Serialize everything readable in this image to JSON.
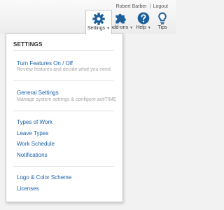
{
  "header": {
    "user_name": "Robert Barber",
    "logout_label": "Logout"
  },
  "nav": {
    "settings": {
      "label": "Settings",
      "icon": "gear-icon"
    },
    "addons": {
      "label": "Add-ons",
      "icon": "puzzle-icon"
    },
    "help": {
      "label": "Help",
      "icon": "help-icon"
    },
    "tips": {
      "label": "Tips",
      "icon": "lightbulb-icon"
    }
  },
  "menu": {
    "title": "SETTINGS",
    "turn_features": {
      "label": "Turn Features On / Off",
      "description": "Review features and decide what you need"
    },
    "general_settings": {
      "label": "General Settings",
      "description": "Manage system settings & configure actiTIME"
    },
    "items": [
      "Types of Work",
      "Leave Types",
      "Work Schedule",
      "Notifications"
    ],
    "bottom_items": [
      "Logo & Color Scheme",
      "Licenses"
    ]
  },
  "colors": {
    "link": "#1a5fa8",
    "icon": "#1d5f9a",
    "description": "#a3a3a3"
  }
}
